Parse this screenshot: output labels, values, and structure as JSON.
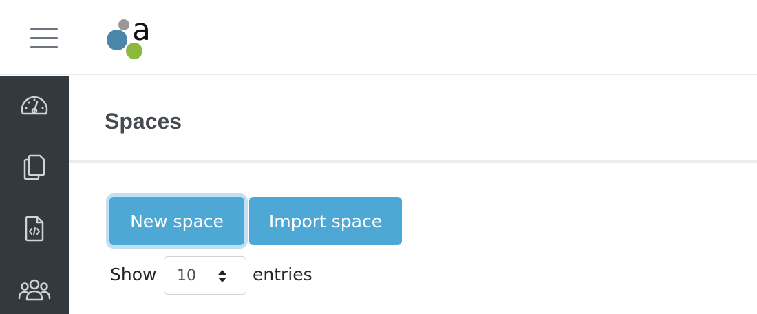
{
  "header": {
    "menu_icon": "hamburger-icon",
    "logo_letter": "a",
    "logo_colors": {
      "grey": "#9c9799",
      "blue": "#4a86aa",
      "green": "#8cba3d"
    }
  },
  "sidebar": {
    "background": "#33393f",
    "items": [
      {
        "icon": "dashboard-icon"
      },
      {
        "icon": "copy-icon"
      },
      {
        "icon": "code-file-icon"
      },
      {
        "icon": "users-icon"
      }
    ]
  },
  "page": {
    "title": "Spaces"
  },
  "actions": {
    "new_space_label": "New space",
    "import_space_label": "Import space",
    "button_color": "#4ea8d6"
  },
  "table_length": {
    "prefix": "Show",
    "value": "10",
    "suffix": "entries"
  }
}
